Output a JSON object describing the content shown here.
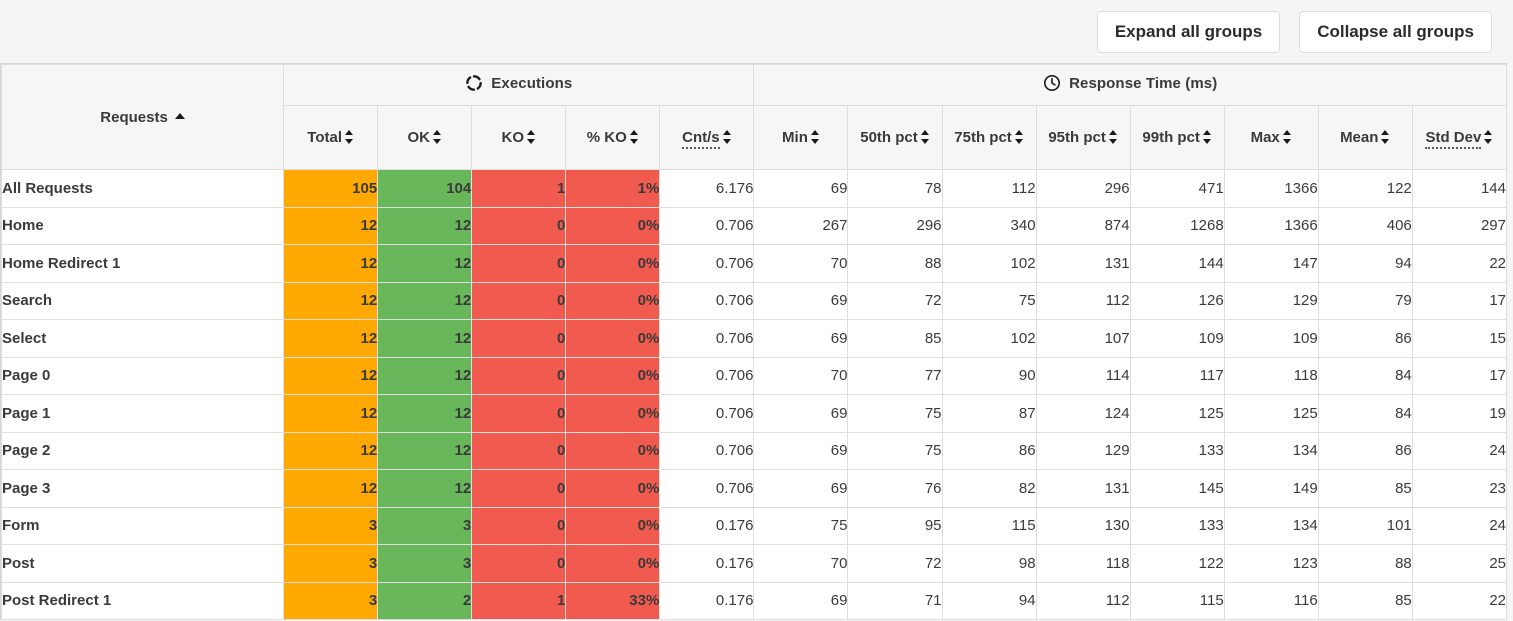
{
  "toolbar": {
    "expand_label": "Expand all groups",
    "collapse_label": "Collapse all groups"
  },
  "table": {
    "requests_header": "Requests",
    "requests_sort": "ascending",
    "groups": [
      {
        "label": "Executions",
        "icon": "sync-icon"
      },
      {
        "label": "Response Time (ms)",
        "icon": "clock-icon"
      }
    ],
    "columns": [
      {
        "key": "total",
        "label": "Total",
        "sortable": true,
        "dotted": false
      },
      {
        "key": "ok",
        "label": "OK",
        "sortable": true,
        "dotted": false
      },
      {
        "key": "ko",
        "label": "KO",
        "sortable": true,
        "dotted": false
      },
      {
        "key": "pct_ko",
        "label": "% KO",
        "sortable": true,
        "dotted": false
      },
      {
        "key": "cnt_s",
        "label": "Cnt/s",
        "sortable": true,
        "dotted": true
      },
      {
        "key": "min",
        "label": "Min",
        "sortable": true,
        "dotted": false
      },
      {
        "key": "p50",
        "label": "50th pct",
        "sortable": true,
        "dotted": false
      },
      {
        "key": "p75",
        "label": "75th pct",
        "sortable": true,
        "dotted": false
      },
      {
        "key": "p95",
        "label": "95th pct",
        "sortable": true,
        "dotted": false
      },
      {
        "key": "p99",
        "label": "99th pct",
        "sortable": true,
        "dotted": false
      },
      {
        "key": "max",
        "label": "Max",
        "sortable": true,
        "dotted": false
      },
      {
        "key": "mean",
        "label": "Mean",
        "sortable": true,
        "dotted": false
      },
      {
        "key": "stddev",
        "label": "Std Dev",
        "sortable": true,
        "dotted": true
      }
    ],
    "rows": [
      {
        "name": "All Requests",
        "total": "105",
        "ok": "104",
        "ko": "1",
        "pct_ko": "1%",
        "cnt_s": "6.176",
        "min": "69",
        "p50": "78",
        "p75": "112",
        "p95": "296",
        "p99": "471",
        "max": "1366",
        "mean": "122",
        "stddev": "144"
      },
      {
        "name": "Home",
        "total": "12",
        "ok": "12",
        "ko": "0",
        "pct_ko": "0%",
        "cnt_s": "0.706",
        "min": "267",
        "p50": "296",
        "p75": "340",
        "p95": "874",
        "p99": "1268",
        "max": "1366",
        "mean": "406",
        "stddev": "297"
      },
      {
        "name": "Home Redirect 1",
        "total": "12",
        "ok": "12",
        "ko": "0",
        "pct_ko": "0%",
        "cnt_s": "0.706",
        "min": "70",
        "p50": "88",
        "p75": "102",
        "p95": "131",
        "p99": "144",
        "max": "147",
        "mean": "94",
        "stddev": "22"
      },
      {
        "name": "Search",
        "total": "12",
        "ok": "12",
        "ko": "0",
        "pct_ko": "0%",
        "cnt_s": "0.706",
        "min": "69",
        "p50": "72",
        "p75": "75",
        "p95": "112",
        "p99": "126",
        "max": "129",
        "mean": "79",
        "stddev": "17"
      },
      {
        "name": "Select",
        "total": "12",
        "ok": "12",
        "ko": "0",
        "pct_ko": "0%",
        "cnt_s": "0.706",
        "min": "69",
        "p50": "85",
        "p75": "102",
        "p95": "107",
        "p99": "109",
        "max": "109",
        "mean": "86",
        "stddev": "15"
      },
      {
        "name": "Page 0",
        "total": "12",
        "ok": "12",
        "ko": "0",
        "pct_ko": "0%",
        "cnt_s": "0.706",
        "min": "70",
        "p50": "77",
        "p75": "90",
        "p95": "114",
        "p99": "117",
        "max": "118",
        "mean": "84",
        "stddev": "17"
      },
      {
        "name": "Page 1",
        "total": "12",
        "ok": "12",
        "ko": "0",
        "pct_ko": "0%",
        "cnt_s": "0.706",
        "min": "69",
        "p50": "75",
        "p75": "87",
        "p95": "124",
        "p99": "125",
        "max": "125",
        "mean": "84",
        "stddev": "19"
      },
      {
        "name": "Page 2",
        "total": "12",
        "ok": "12",
        "ko": "0",
        "pct_ko": "0%",
        "cnt_s": "0.706",
        "min": "69",
        "p50": "75",
        "p75": "86",
        "p95": "129",
        "p99": "133",
        "max": "134",
        "mean": "86",
        "stddev": "24"
      },
      {
        "name": "Page 3",
        "total": "12",
        "ok": "12",
        "ko": "0",
        "pct_ko": "0%",
        "cnt_s": "0.706",
        "min": "69",
        "p50": "76",
        "p75": "82",
        "p95": "131",
        "p99": "145",
        "max": "149",
        "mean": "85",
        "stddev": "23"
      },
      {
        "name": "Form",
        "total": "3",
        "ok": "3",
        "ko": "0",
        "pct_ko": "0%",
        "cnt_s": "0.176",
        "min": "75",
        "p50": "95",
        "p75": "115",
        "p95": "130",
        "p99": "133",
        "max": "134",
        "mean": "101",
        "stddev": "24"
      },
      {
        "name": "Post",
        "total": "3",
        "ok": "3",
        "ko": "0",
        "pct_ko": "0%",
        "cnt_s": "0.176",
        "min": "70",
        "p50": "72",
        "p75": "98",
        "p95": "118",
        "p99": "122",
        "max": "123",
        "mean": "88",
        "stddev": "25"
      },
      {
        "name": "Post Redirect 1",
        "total": "3",
        "ok": "2",
        "ko": "1",
        "pct_ko": "33%",
        "cnt_s": "0.176",
        "min": "69",
        "p50": "71",
        "p75": "94",
        "p95": "112",
        "p99": "115",
        "max": "116",
        "mean": "85",
        "stddev": "22"
      }
    ]
  },
  "colors": {
    "total_bg": "#ffa801",
    "ok_bg": "#68b75b",
    "ko_bg": "#f15b4f",
    "page_bg": "#f5f5f5",
    "header_bg": "#f6f6f6",
    "border": "#dedede"
  }
}
